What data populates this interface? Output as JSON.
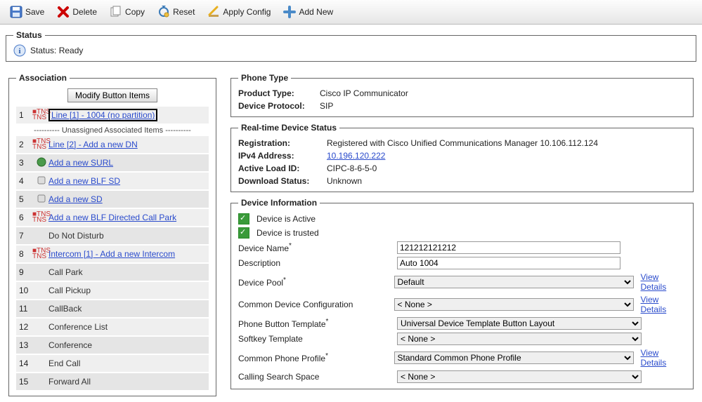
{
  "toolbar": {
    "save": "Save",
    "delete": "Delete",
    "copy": "Copy",
    "reset": "Reset",
    "apply": "Apply Config",
    "addnew": "Add New"
  },
  "status": {
    "legend": "Status",
    "text": "Status: Ready"
  },
  "assoc": {
    "legend": "Association",
    "modify_btn": "Modify Button Items",
    "separator": "---------- Unassigned Associated Items ----------",
    "items": [
      {
        "n": "1",
        "label": "Line [1] - 1004 (no partition)",
        "link": true,
        "selected": true,
        "icon": "line"
      },
      {
        "n": "2",
        "label": "Line [2] - Add a new DN",
        "link": true,
        "icon": "line"
      },
      {
        "n": "3",
        "label": "Add a new SURL",
        "link": true,
        "icon": "globe"
      },
      {
        "n": "4",
        "label": "Add a new BLF SD",
        "link": true,
        "icon": "phone"
      },
      {
        "n": "5",
        "label": "Add a new SD",
        "link": true,
        "icon": "phone"
      },
      {
        "n": "6",
        "label": "Add a new BLF Directed Call Park",
        "link": true,
        "icon": "line"
      },
      {
        "n": "7",
        "label": "Do Not Disturb",
        "link": false
      },
      {
        "n": "8",
        "label": "Intercom [1] - Add a new Intercom",
        "link": true,
        "icon": "line"
      },
      {
        "n": "9",
        "label": "Call Park",
        "link": false
      },
      {
        "n": "10",
        "label": "Call Pickup",
        "link": false
      },
      {
        "n": "11",
        "label": "CallBack",
        "link": false
      },
      {
        "n": "12",
        "label": "Conference List",
        "link": false
      },
      {
        "n": "13",
        "label": "Conference",
        "link": false
      },
      {
        "n": "14",
        "label": "End Call",
        "link": false
      },
      {
        "n": "15",
        "label": "Forward All",
        "link": false
      }
    ]
  },
  "phone_type": {
    "legend": "Phone Type",
    "product_label": "Product Type:",
    "product_value": "Cisco IP Communicator",
    "protocol_label": "Device Protocol:",
    "protocol_value": "SIP"
  },
  "rt_status": {
    "legend": "Real-time Device Status",
    "reg_label": "Registration:",
    "reg_value": "Registered with Cisco Unified Communications Manager 10.106.112.124",
    "ip_label": "IPv4 Address:",
    "ip_value": "10.196.120.222",
    "load_label": "Active Load ID:",
    "load_value": "CIPC-8-6-5-0",
    "dl_label": "Download Status:",
    "dl_value": "Unknown"
  },
  "dev_info": {
    "legend": "Device Information",
    "active": "Device is Active",
    "trusted": "Device is trusted",
    "name_label": "Device Name",
    "name_value": "121212121212",
    "desc_label": "Description",
    "desc_value": "Auto 1004",
    "pool_label": "Device Pool",
    "pool_value": "Default",
    "cdc_label": "Common Device Configuration",
    "cdc_value": "< None >",
    "pbt_label": "Phone Button Template",
    "pbt_value": "Universal Device Template Button Layout",
    "sk_label": "Softkey Template",
    "sk_value": "< None >",
    "cpp_label": "Common Phone Profile",
    "cpp_value": "Standard Common Phone Profile",
    "css_label": "Calling Search Space",
    "css_value": "< None >",
    "view_details": "View Details"
  }
}
